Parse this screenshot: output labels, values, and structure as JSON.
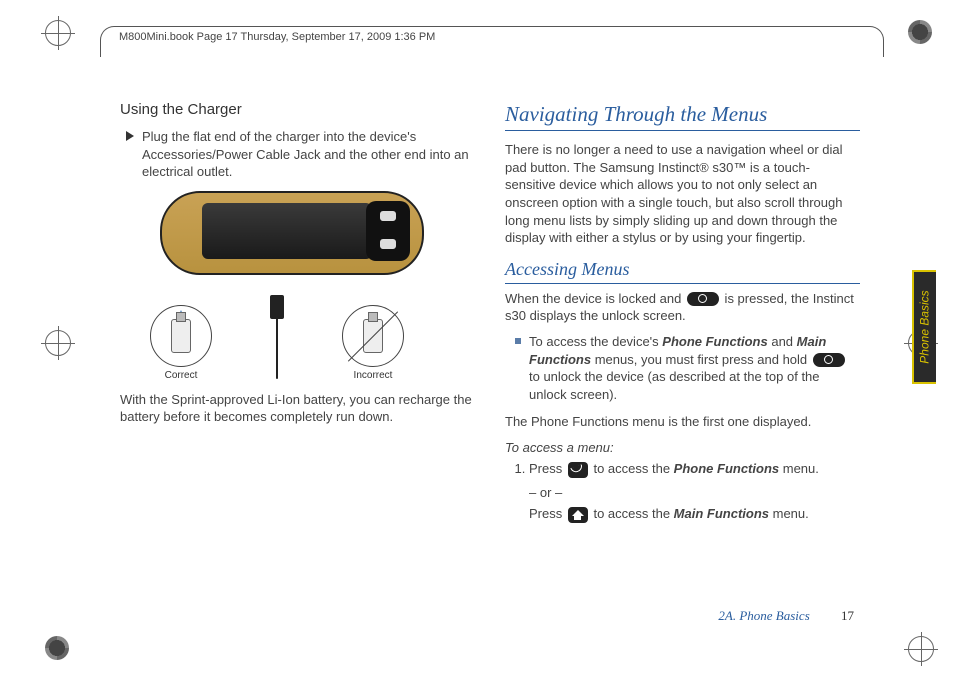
{
  "header": "M800Mini.book  Page 17  Thursday, September 17, 2009  1:36 PM",
  "left": {
    "heading": "Using the Charger",
    "bullet": "Plug the flat end of the charger into the device's Accessories/Power Cable Jack and the other end into an electrical outlet.",
    "correct": "Correct",
    "incorrect": "Incorrect",
    "note": "With the Sprint-approved Li-Ion battery, you can recharge the battery before it becomes completely run down."
  },
  "right": {
    "title": "Navigating Through the Menus",
    "intro": "There is no longer a need to use a navigation wheel or dial pad button. The Samsung Instinct® s30™ is a touch-sensitive device which allows you to not only select an onscreen option with a single touch, but also scroll through long menu lists by simply sliding up and down through the display with either a stylus or by using your fingertip.",
    "sub1": "Accessing Menus",
    "locked_a": "When the device is locked and ",
    "locked_b": " is pressed, the Instinct s30 displays the unlock screen.",
    "access_a": "To access the device's ",
    "access_pf": "Phone Functions",
    "access_b": " and ",
    "access_mf": "Main Functions",
    "access_c": " menus, you must first press and hold ",
    "access_d": " to unlock the device (as described at the top of the unlock screen).",
    "first_menu": "The Phone Functions menu is the first one displayed.",
    "to_access": "To access a menu:",
    "step1_a": "Press ",
    "step1_b": " to access the ",
    "step1_pf": "Phone Functions",
    "step1_c": " menu.",
    "or": "– or –",
    "step2_a": "Press ",
    "step2_b": " to access the ",
    "step2_mf": "Main Functions",
    "step2_c": " menu."
  },
  "sidetab": "Phone Basics",
  "footer_section": "2A. Phone Basics",
  "footer_page": "17"
}
